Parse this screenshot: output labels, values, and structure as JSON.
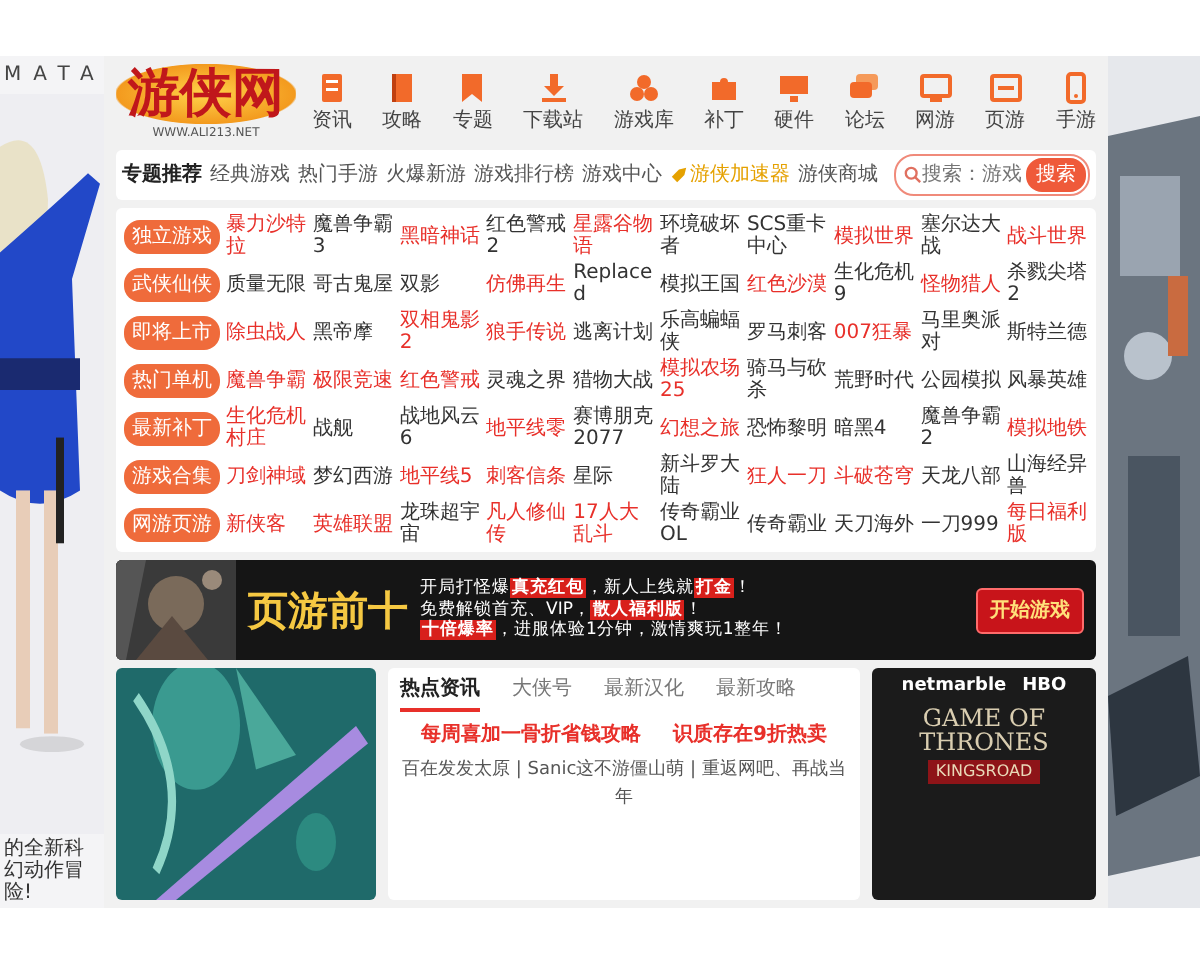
{
  "left_art": {
    "heading": "MATA",
    "caption": "的全新科幻动作冒险!"
  },
  "header": {
    "logo": "游侠网",
    "logo_url": "WWW.ALI213.NET",
    "nav": [
      {
        "label": "资讯"
      },
      {
        "label": "攻略"
      },
      {
        "label": "专题"
      },
      {
        "label": "下载站"
      },
      {
        "label": "游戏库"
      },
      {
        "label": "补丁"
      },
      {
        "label": "硬件"
      },
      {
        "label": "论坛"
      },
      {
        "label": "网游"
      },
      {
        "label": "页游"
      },
      {
        "label": "手游"
      }
    ]
  },
  "tabs": [
    {
      "label": "专题推荐",
      "selected": true,
      "kind": "text"
    },
    {
      "label": "经典游戏",
      "selected": false,
      "kind": "text"
    },
    {
      "label": "热门手游",
      "selected": false,
      "kind": "text"
    },
    {
      "label": "火爆新游",
      "selected": false,
      "kind": "text"
    },
    {
      "label": "游戏排行榜",
      "selected": false,
      "kind": "text"
    },
    {
      "label": "游戏中心",
      "selected": false,
      "kind": "text"
    },
    {
      "label": "游侠加速器",
      "selected": false,
      "kind": "accelerator"
    },
    {
      "label": "游侠商城",
      "selected": false,
      "kind": "text"
    }
  ],
  "search": {
    "placeholder": "搜索：游戏",
    "button": "搜索"
  },
  "categories": [
    {
      "label": "独立游戏",
      "links": [
        {
          "text": "暴力沙特拉",
          "hot": true
        },
        {
          "text": "魔兽争霸3",
          "hot": false
        },
        {
          "text": "黑暗神话",
          "hot": true
        },
        {
          "text": "红色警戒2",
          "hot": false
        },
        {
          "text": "星露谷物语",
          "hot": true
        },
        {
          "text": "环境破坏者",
          "hot": false
        },
        {
          "text": "SCS重卡中心",
          "hot": false
        },
        {
          "text": "模拟世界",
          "hot": true
        },
        {
          "text": "塞尔达大战",
          "hot": false
        },
        {
          "text": "战斗世界",
          "hot": true
        }
      ]
    },
    {
      "label": "武侠仙侠",
      "links": [
        {
          "text": "质量无限",
          "hot": false
        },
        {
          "text": "哥古鬼屋",
          "hot": false
        },
        {
          "text": "双影",
          "hot": false
        },
        {
          "text": "仿佛再生",
          "hot": true
        },
        {
          "text": "Replaced",
          "hot": false
        },
        {
          "text": "模拟王国",
          "hot": false
        },
        {
          "text": "红色沙漠",
          "hot": true
        },
        {
          "text": "生化危机9",
          "hot": false
        },
        {
          "text": "怪物猎人",
          "hot": true
        },
        {
          "text": "杀戮尖塔2",
          "hot": false
        }
      ]
    },
    {
      "label": "即将上市",
      "links": [
        {
          "text": "除虫战人",
          "hot": true
        },
        {
          "text": "黑帝摩",
          "hot": false
        },
        {
          "text": "双相鬼影2",
          "hot": true
        },
        {
          "text": "狼手传说",
          "hot": true
        },
        {
          "text": "逃离计划",
          "hot": false
        },
        {
          "text": "乐高蝙蝠侠",
          "hot": false
        },
        {
          "text": "罗马刺客",
          "hot": false
        },
        {
          "text": "007狂暴",
          "hot": true
        },
        {
          "text": "马里奥派对",
          "hot": false
        },
        {
          "text": "斯特兰德",
          "hot": false
        }
      ]
    },
    {
      "label": "热门单机",
      "links": [
        {
          "text": "魔兽争霸",
          "hot": true
        },
        {
          "text": "极限竞速",
          "hot": true
        },
        {
          "text": "红色警戒",
          "hot": true
        },
        {
          "text": "灵魂之界",
          "hot": false
        },
        {
          "text": "猎物大战",
          "hot": false
        },
        {
          "text": "模拟农场25",
          "hot": true
        },
        {
          "text": "骑马与砍杀",
          "hot": false
        },
        {
          "text": "荒野时代",
          "hot": false
        },
        {
          "text": "公园模拟",
          "hot": false
        },
        {
          "text": "风暴英雄",
          "hot": false
        }
      ]
    },
    {
      "label": "最新补丁",
      "links": [
        {
          "text": "生化危机村庄",
          "hot": true
        },
        {
          "text": "战舰",
          "hot": false
        },
        {
          "text": "战地风云6",
          "hot": false
        },
        {
          "text": "地平线零",
          "hot": true
        },
        {
          "text": "赛博朋克2077",
          "hot": false
        },
        {
          "text": "幻想之旅",
          "hot": true
        },
        {
          "text": "恐怖黎明",
          "hot": false
        },
        {
          "text": "暗黑4",
          "hot": false
        },
        {
          "text": "魔兽争霸2",
          "hot": false
        },
        {
          "text": "模拟地铁",
          "hot": true
        }
      ]
    },
    {
      "label": "游戏合集",
      "links": [
        {
          "text": "刀剑神域",
          "hot": true
        },
        {
          "text": "梦幻西游",
          "hot": false
        },
        {
          "text": "地平线5",
          "hot": true
        },
        {
          "text": "刺客信条",
          "hot": true
        },
        {
          "text": "星际",
          "hot": false
        },
        {
          "text": "新斗罗大陆",
          "hot": false
        },
        {
          "text": "狂人一刀",
          "hot": true
        },
        {
          "text": "斗破苍穹",
          "hot": true
        },
        {
          "text": "天龙八部",
          "hot": false
        },
        {
          "text": "山海经异兽",
          "hot": false
        }
      ]
    },
    {
      "label": "网游页游",
      "links": [
        {
          "text": "新侠客",
          "hot": true
        },
        {
          "text": "英雄联盟",
          "hot": true
        },
        {
          "text": "龙珠超宇宙",
          "hot": false
        },
        {
          "text": "凡人修仙传",
          "hot": true
        },
        {
          "text": "17人大乱斗",
          "hot": true
        },
        {
          "text": "传奇霸业OL",
          "hot": false
        },
        {
          "text": "传奇霸业",
          "hot": false
        },
        {
          "text": "天刀海外",
          "hot": false
        },
        {
          "text": "一刀999",
          "hot": false
        },
        {
          "text": "每日福利版",
          "hot": true
        }
      ]
    }
  ],
  "banner": {
    "title": "页游前十",
    "lines": [
      "开局打怪爆**真充红包**，新人上线就**打金**！",
      "免费解锁首充、VIP，**散人福利版**！",
      "**十倍爆率**，进服体验1分钟，激情爽玩1整年！"
    ],
    "button": "开始游戏"
  },
  "news": {
    "tabs": [
      {
        "label": "热点资讯",
        "selected": true
      },
      {
        "label": "大侠号",
        "selected": false
      },
      {
        "label": "最新汉化",
        "selected": false
      },
      {
        "label": "最新攻略",
        "selected": false
      }
    ],
    "headlines": [
      "每周喜加一骨折省钱攻略",
      "识质存在9折热卖"
    ],
    "summary": "百在发发太原 | Sanic这不游僵山萌 | 重返网吧、再战当年"
  },
  "ad": {
    "brand": "netmarble",
    "network": "HBO",
    "title": "GAME OF THRONES",
    "subtitle": "KINGSROAD"
  }
}
